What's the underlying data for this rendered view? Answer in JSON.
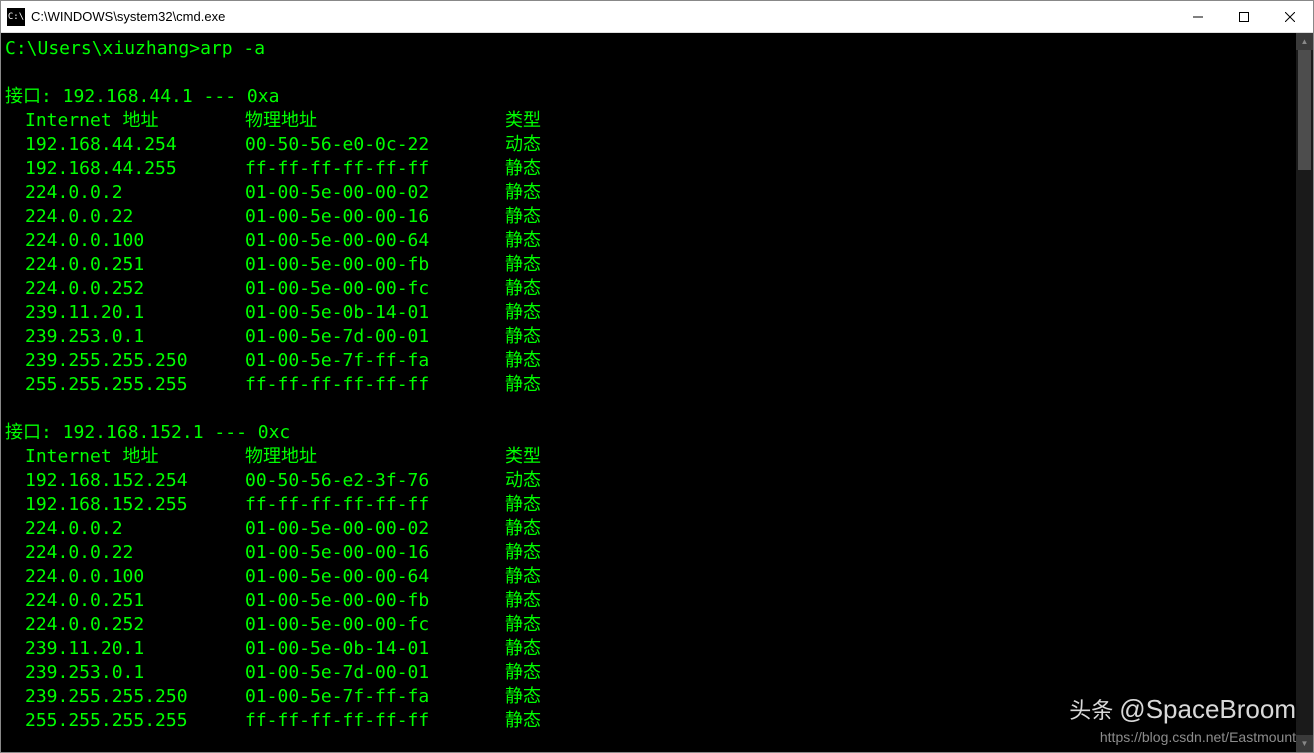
{
  "window": {
    "title": "C:\\WINDOWS\\system32\\cmd.exe",
    "icon_label": "C:\\"
  },
  "prompt": "C:\\Users\\xiuzhang>arp -a",
  "columns": {
    "ip": "Internet 地址",
    "mac": "物理地址",
    "type": "类型"
  },
  "interfaces": [
    {
      "header": "接口: 192.168.44.1 --- 0xa",
      "entries": [
        {
          "ip": "192.168.44.254",
          "mac": "00-50-56-e0-0c-22",
          "type": "动态"
        },
        {
          "ip": "192.168.44.255",
          "mac": "ff-ff-ff-ff-ff-ff",
          "type": "静态"
        },
        {
          "ip": "224.0.0.2",
          "mac": "01-00-5e-00-00-02",
          "type": "静态"
        },
        {
          "ip": "224.0.0.22",
          "mac": "01-00-5e-00-00-16",
          "type": "静态"
        },
        {
          "ip": "224.0.0.100",
          "mac": "01-00-5e-00-00-64",
          "type": "静态"
        },
        {
          "ip": "224.0.0.251",
          "mac": "01-00-5e-00-00-fb",
          "type": "静态"
        },
        {
          "ip": "224.0.0.252",
          "mac": "01-00-5e-00-00-fc",
          "type": "静态"
        },
        {
          "ip": "239.11.20.1",
          "mac": "01-00-5e-0b-14-01",
          "type": "静态"
        },
        {
          "ip": "239.253.0.1",
          "mac": "01-00-5e-7d-00-01",
          "type": "静态"
        },
        {
          "ip": "239.255.255.250",
          "mac": "01-00-5e-7f-ff-fa",
          "type": "静态"
        },
        {
          "ip": "255.255.255.255",
          "mac": "ff-ff-ff-ff-ff-ff",
          "type": "静态"
        }
      ]
    },
    {
      "header": "接口: 192.168.152.1 --- 0xc",
      "entries": [
        {
          "ip": "192.168.152.254",
          "mac": "00-50-56-e2-3f-76",
          "type": "动态"
        },
        {
          "ip": "192.168.152.255",
          "mac": "ff-ff-ff-ff-ff-ff",
          "type": "静态"
        },
        {
          "ip": "224.0.0.2",
          "mac": "01-00-5e-00-00-02",
          "type": "静态"
        },
        {
          "ip": "224.0.0.22",
          "mac": "01-00-5e-00-00-16",
          "type": "静态"
        },
        {
          "ip": "224.0.0.100",
          "mac": "01-00-5e-00-00-64",
          "type": "静态"
        },
        {
          "ip": "224.0.0.251",
          "mac": "01-00-5e-00-00-fb",
          "type": "静态"
        },
        {
          "ip": "224.0.0.252",
          "mac": "01-00-5e-00-00-fc",
          "type": "静态"
        },
        {
          "ip": "239.11.20.1",
          "mac": "01-00-5e-0b-14-01",
          "type": "静态"
        },
        {
          "ip": "239.253.0.1",
          "mac": "01-00-5e-7d-00-01",
          "type": "静态"
        },
        {
          "ip": "239.255.255.250",
          "mac": "01-00-5e-7f-ff-fa",
          "type": "静态"
        },
        {
          "ip": "255.255.255.255",
          "mac": "ff-ff-ff-ff-ff-ff",
          "type": "静态"
        }
      ]
    }
  ],
  "watermark": {
    "main_prefix": "头条",
    "main_handle": "@SpaceBroom",
    "url": "https://blog.csdn.net/Eastmount"
  }
}
